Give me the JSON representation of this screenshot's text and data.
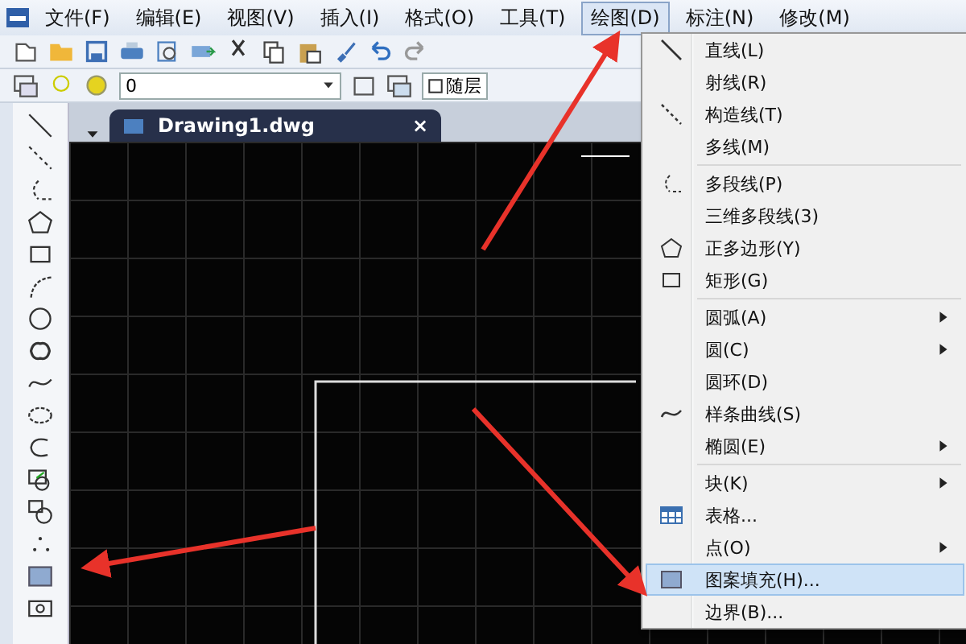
{
  "menu_bar": {
    "items": [
      {
        "label": "文件(F)",
        "selected": false
      },
      {
        "label": "编辑(E)",
        "selected": false
      },
      {
        "label": "视图(V)",
        "selected": false
      },
      {
        "label": "插入(I)",
        "selected": false
      },
      {
        "label": "格式(O)",
        "selected": false
      },
      {
        "label": "工具(T)",
        "selected": false
      },
      {
        "label": "绘图(D)",
        "selected": true
      },
      {
        "label": "标注(N)",
        "selected": false
      },
      {
        "label": "修改(M)",
        "selected": false
      }
    ]
  },
  "layer_toolbar": {
    "layer_value": "0",
    "linetype_value": "随层"
  },
  "document_tab": {
    "title": "Drawing1.dwg",
    "close": "×"
  },
  "draw_menu": {
    "items": [
      {
        "kind": "item",
        "label": "直线(L)",
        "submenu": false,
        "selected": false
      },
      {
        "kind": "item",
        "label": "射线(R)",
        "submenu": false,
        "selected": false
      },
      {
        "kind": "item",
        "label": "构造线(T)",
        "submenu": false,
        "selected": false
      },
      {
        "kind": "item",
        "label": "多线(M)",
        "submenu": false,
        "selected": false
      },
      {
        "kind": "separator"
      },
      {
        "kind": "item",
        "label": "多段线(P)",
        "submenu": false,
        "selected": false
      },
      {
        "kind": "item",
        "label": "三维多段线(3)",
        "submenu": false,
        "selected": false
      },
      {
        "kind": "item",
        "label": "正多边形(Y)",
        "submenu": false,
        "selected": false
      },
      {
        "kind": "item",
        "label": "矩形(G)",
        "submenu": false,
        "selected": false
      },
      {
        "kind": "separator"
      },
      {
        "kind": "item",
        "label": "圆弧(A)",
        "submenu": true,
        "selected": false
      },
      {
        "kind": "item",
        "label": "圆(C)",
        "submenu": true,
        "selected": false
      },
      {
        "kind": "item",
        "label": "圆环(D)",
        "submenu": false,
        "selected": false
      },
      {
        "kind": "item",
        "label": "样条曲线(S)",
        "submenu": false,
        "selected": false
      },
      {
        "kind": "item",
        "label": "椭圆(E)",
        "submenu": true,
        "selected": false
      },
      {
        "kind": "separator"
      },
      {
        "kind": "item",
        "label": "块(K)",
        "submenu": true,
        "selected": false
      },
      {
        "kind": "item",
        "label": "表格...",
        "submenu": false,
        "selected": false
      },
      {
        "kind": "item",
        "label": "点(O)",
        "submenu": true,
        "selected": false
      },
      {
        "kind": "item",
        "label": "图案填充(H)...",
        "submenu": false,
        "selected": true
      },
      {
        "kind": "item",
        "label": "边界(B)...",
        "submenu": false,
        "selected": false
      }
    ]
  }
}
